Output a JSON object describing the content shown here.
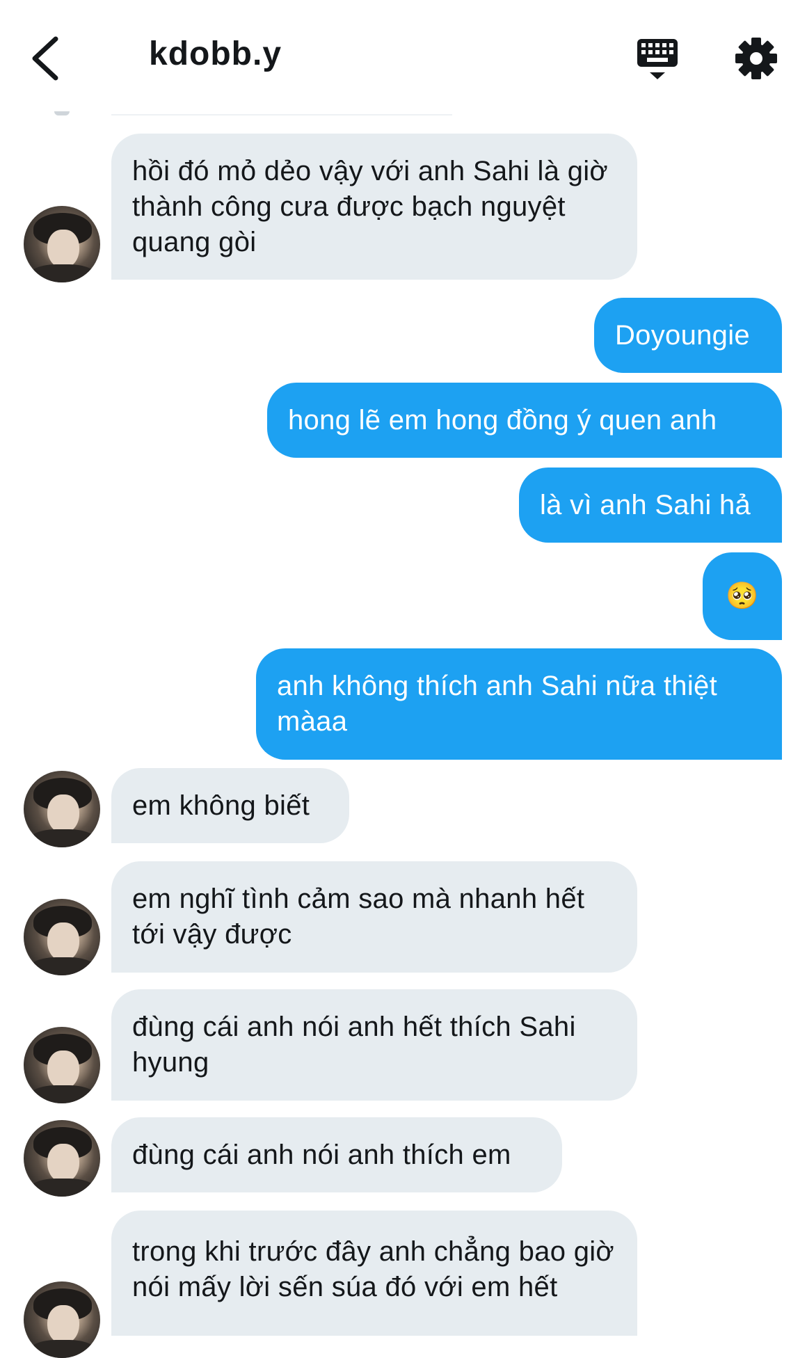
{
  "header": {
    "title": "kdobb.y",
    "back_icon": "chevron-left-icon",
    "keyboard_icon": "keyboard-icon",
    "settings_icon": "gear-icon"
  },
  "colors": {
    "incoming_bubble": "#e6ecf0",
    "outgoing_bubble": "#1da1f2",
    "outgoing_text": "#ffffff",
    "text": "#14171a"
  },
  "messages": [
    {
      "from": "other",
      "text": "hồi đó mỏ dẻo vậy với anh Sahi là giờ thành công cưa được bạch nguyệt quang gòi"
    },
    {
      "from": "me",
      "text": "Doyoungie"
    },
    {
      "from": "me",
      "text": "hong lẽ em hong đồng ý quen anh"
    },
    {
      "from": "me",
      "text": "là vì anh Sahi hả"
    },
    {
      "from": "me",
      "text": "🥺"
    },
    {
      "from": "me",
      "text": "anh không thích anh Sahi nữa thiệt màaa"
    },
    {
      "from": "other",
      "text": "em không biết"
    },
    {
      "from": "other",
      "text": "em nghĩ tình cảm sao mà nhanh hết tới vậy được"
    },
    {
      "from": "other",
      "text": "đùng cái anh nói anh hết thích Sahi hyung"
    },
    {
      "from": "other",
      "text": "đùng cái anh nói anh thích em"
    },
    {
      "from": "other",
      "text": "trong khi trước đây anh chẳng bao giờ nói mấy lời sến súa đó với em hết"
    }
  ]
}
